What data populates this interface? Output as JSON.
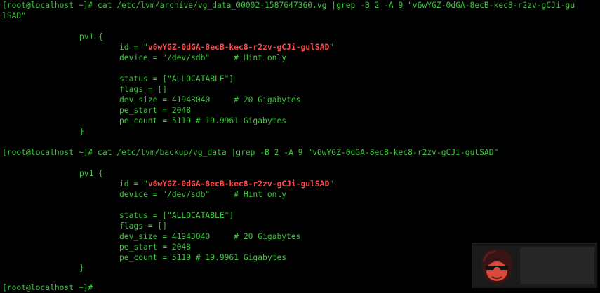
{
  "terminal": {
    "block1": {
      "command_line_1": "[root@localhost ~]# cat /etc/lvm/archive/vg_data_00002-1587647360.vg |grep -B 2 -A 9 \"v6wYGZ-0dGA-8ecB-kec8-r2zv-gCJi-gu",
      "command_line_2": "lSAD\"",
      "pv_open": "pv1 {",
      "id_prefix": "id = \"",
      "id_value": "v6wYGZ-0dGA-8ecB-kec8-r2zv-gCJi-gulSAD",
      "id_suffix": "\"",
      "device": "device = \"/dev/sdb\"     # Hint only",
      "status": "status = [\"ALLOCATABLE\"]",
      "flags": "flags = []",
      "dev_size": "dev_size = 41943040     # 20 Gigabytes",
      "pe_start": "pe_start = 2048",
      "pe_count": "pe_count = 5119 # 19.9961 Gigabytes",
      "pv_close": "}"
    },
    "block2": {
      "command_line": "[root@localhost ~]# cat /etc/lvm/backup/vg_data |grep -B 2 -A 9 \"v6wYGZ-0dGA-8ecB-kec8-r2zv-gCJi-gulSAD\"",
      "pv_open": "pv1 {",
      "id_prefix": "id = \"",
      "id_value": "v6wYGZ-0dGA-8ecB-kec8-r2zv-gCJi-gulSAD",
      "id_suffix": "\"",
      "device": "device = \"/dev/sdb\"     # Hint only",
      "status": "status = [\"ALLOCATABLE\"]",
      "flags": "flags = []",
      "dev_size": "dev_size = 41943040     # 20 Gigabytes",
      "pe_start": "pe_start = 2048",
      "pe_count": "pe_count = 5119 # 19.9961 Gigabytes",
      "pv_close": "}"
    },
    "next_prompt": "[root@localhost ~]#"
  },
  "colors": {
    "background": "#000000",
    "text": "#3cc83c",
    "highlight": "#ff4a4a"
  },
  "icons": {
    "watermark": "sunglasses-mascot-icon"
  }
}
